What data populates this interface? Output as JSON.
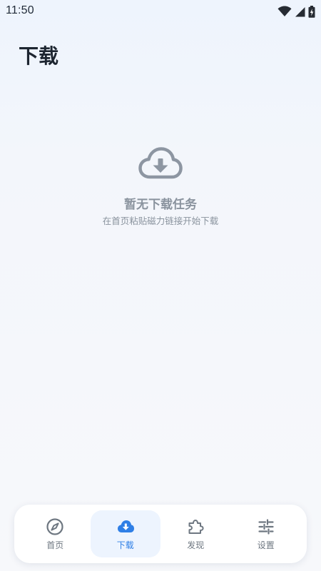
{
  "status_bar": {
    "time": "11:50",
    "icons": [
      "wifi-icon",
      "cellular-signal-icon",
      "battery-charging-icon"
    ]
  },
  "page": {
    "title": "下载"
  },
  "empty_state": {
    "icon": "cloud-download-icon",
    "title": "暂无下载任务",
    "subtitle": "在首页粘贴磁力链接开始下载"
  },
  "bottom_nav": {
    "active": "download",
    "items": [
      {
        "id": "home",
        "label": "首页",
        "icon": "compass-icon"
      },
      {
        "id": "download",
        "label": "下载",
        "icon": "cloud-download-icon"
      },
      {
        "id": "discover",
        "label": "发现",
        "icon": "puzzle-icon"
      },
      {
        "id": "settings",
        "label": "设置",
        "icon": "sliders-icon"
      }
    ]
  },
  "colors": {
    "accent": "#2f7fe6",
    "muted_text": "#8a939e",
    "nav_text": "#6e7781",
    "title_text": "#1d2530",
    "active_tab_bg": "#edf4fe"
  }
}
